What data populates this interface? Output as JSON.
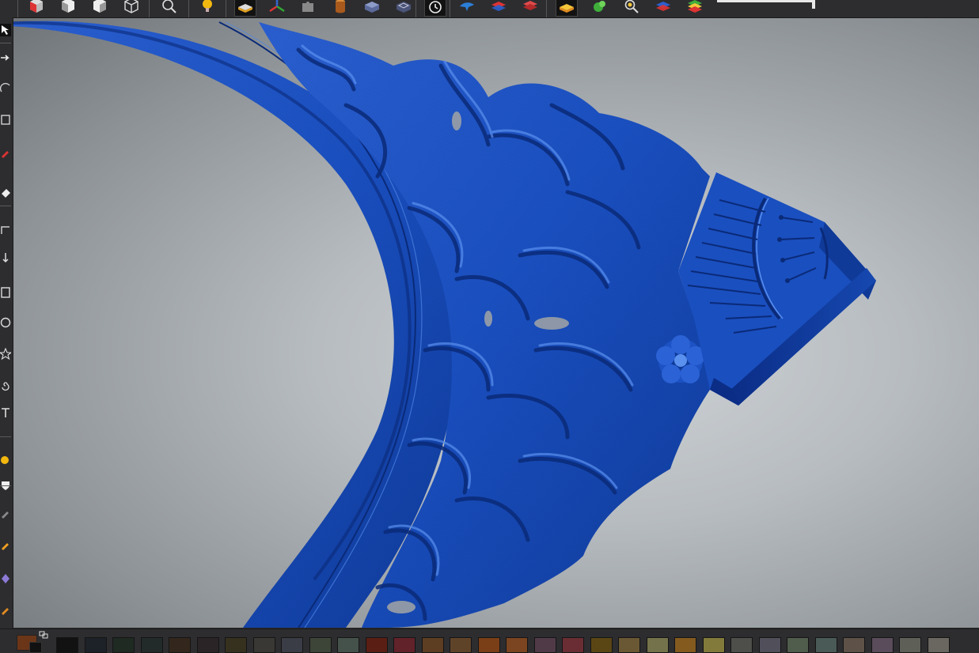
{
  "app": {
    "toolbar": {
      "buttons": [
        {
          "name": "view-iso-shaded-icon",
          "active": false
        },
        {
          "name": "view-front-icon",
          "active": false
        },
        {
          "name": "view-side-icon",
          "active": false
        },
        {
          "name": "view-wire-cube-icon",
          "active": false
        },
        {
          "name": "zoom-icon",
          "active": false
        },
        {
          "name": "light-bulb-icon",
          "active": false
        },
        {
          "name": "layer-shaded-icon",
          "active": true
        },
        {
          "name": "axes-icon",
          "active": false
        },
        {
          "name": "puzzle-icon",
          "active": false
        },
        {
          "name": "cylinder-icon",
          "active": false
        },
        {
          "name": "box-icon",
          "active": false
        },
        {
          "name": "box-outline-icon",
          "active": false
        },
        {
          "name": "rotate-view-icon",
          "active": true
        },
        {
          "name": "bird-icon",
          "active": false
        },
        {
          "name": "layers-red-blue-icon",
          "active": false
        },
        {
          "name": "layers-red-icon",
          "active": false
        },
        {
          "name": "layer-yellow-icon",
          "active": true
        },
        {
          "name": "green-blob-icon",
          "active": false
        },
        {
          "name": "zoom-sparkle-icon",
          "active": false
        },
        {
          "name": "layers-blue-red-icon",
          "active": false
        },
        {
          "name": "layers-multicolor-icon",
          "active": false
        }
      ],
      "slider_level": 0.98
    },
    "left_tools": [
      {
        "name": "select-arrow-icon",
        "active": true
      },
      {
        "name": "arrow-right-icon",
        "active": false
      },
      {
        "name": "arc-icon",
        "active": false
      },
      {
        "name": "transform-box-icon",
        "active": false
      },
      {
        "name": "red-pen-icon",
        "active": false
      },
      {
        "name": "eraser-icon",
        "active": false
      },
      {
        "name": "corner-icon",
        "active": false
      },
      {
        "name": "move-down-icon",
        "active": false
      },
      {
        "name": "rectangle-icon",
        "active": false
      },
      {
        "name": "circle-icon",
        "active": false
      },
      {
        "name": "star-icon",
        "active": false
      },
      {
        "name": "spiral-icon",
        "active": false
      },
      {
        "name": "text-tool-icon",
        "active": false
      },
      {
        "name": "fill-yellow-icon",
        "active": false
      },
      {
        "name": "shield-icon",
        "active": false
      },
      {
        "name": "pencil-gray-icon",
        "active": false
      },
      {
        "name": "pencil-orange-icon",
        "active": false
      },
      {
        "name": "diamond-purple-icon",
        "active": false
      },
      {
        "name": "pencil-orange-2-icon",
        "active": false
      }
    ],
    "palette": {
      "current_color": "#6b3618",
      "swatches": [
        "#121212",
        "#1d2128",
        "#1f2a22",
        "#232a2a",
        "#33261c",
        "#2a2427",
        "#36311f",
        "#3a3834",
        "#3a3c46",
        "#3d4539",
        "#44524b",
        "#5a1e14",
        "#62222a",
        "#5d3e23",
        "#5f4329",
        "#7a3f16",
        "#7a4520",
        "#513a48",
        "#6a2d34",
        "#5a4615",
        "#6a5834",
        "#74724a",
        "#845a1f",
        "#827a3b",
        "#4e4e4a",
        "#504f5a",
        "#505c4c",
        "#4a5a56",
        "#5e5248",
        "#5a4c5a",
        "#5e6058",
        "#6a6660"
      ]
    },
    "colors": {
      "model_blue": "#1a4fbf",
      "model_dark": "#0a2a78",
      "model_light": "#4f86e6",
      "toolbar_bg": "#2d2d30"
    }
  }
}
